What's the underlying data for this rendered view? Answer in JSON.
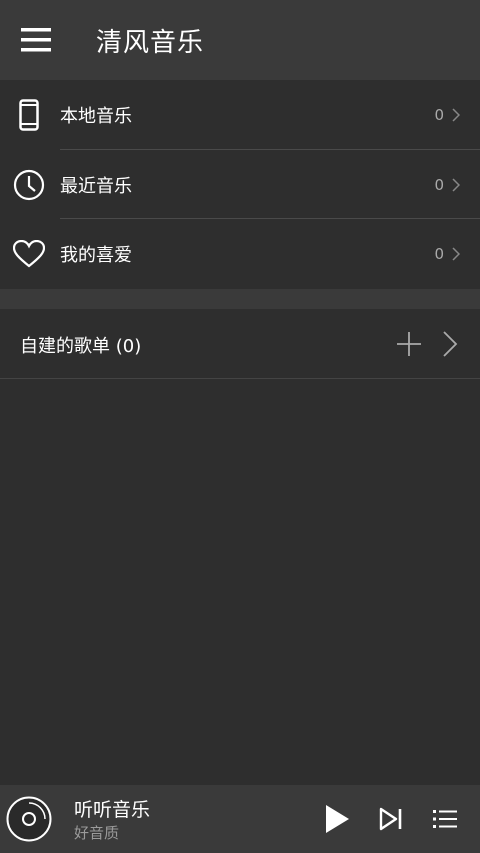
{
  "appbar": {
    "title": "清风音乐"
  },
  "menu": [
    {
      "label": "本地音乐",
      "count": "0",
      "icon": "phone-icon"
    },
    {
      "label": "最近音乐",
      "count": "0",
      "icon": "clock-icon"
    },
    {
      "label": "我的喜爱",
      "count": "0",
      "icon": "heart-icon"
    }
  ],
  "playlists": {
    "label": "自建的歌单 (0)"
  },
  "player": {
    "title": "听听音乐",
    "subtitle": "好音质"
  },
  "colors": {
    "background": "#2e2e2e",
    "bar": "#3a3a3a",
    "text": "#ffffff",
    "muted": "#aaaaaa"
  }
}
